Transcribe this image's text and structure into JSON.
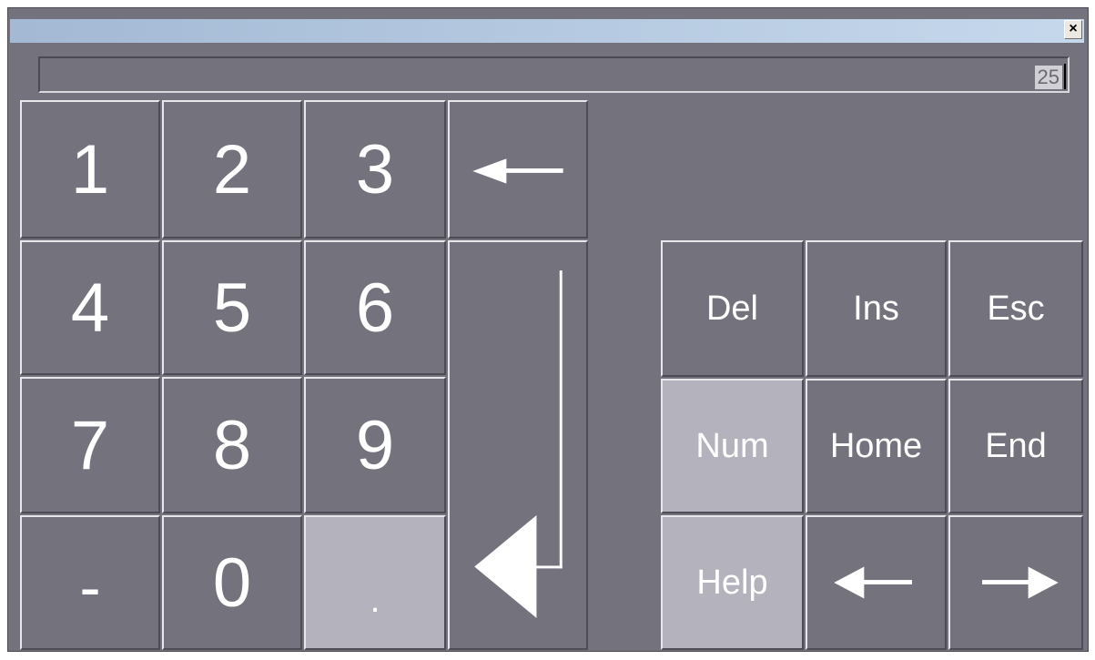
{
  "window": {
    "close_glyph": "×"
  },
  "input": {
    "value": "25"
  },
  "numpad": {
    "k1": "1",
    "k2": "2",
    "k3": "3",
    "k4": "4",
    "k5": "5",
    "k6": "6",
    "k7": "7",
    "k8": "8",
    "k9": "9",
    "minus": "-",
    "k0": "0",
    "dot": "."
  },
  "nav": {
    "del": "Del",
    "ins": "Ins",
    "esc": "Esc",
    "num": "Num",
    "home": "Home",
    "end": "End",
    "help": "Help"
  },
  "icons": {
    "backspace": "left-arrow-icon",
    "enter": "enter-arrow-icon",
    "cursor_left": "left-arrow-icon",
    "cursor_right": "right-arrow-icon"
  },
  "colors": {
    "panel": "#74737d",
    "key_active": "#b4b3bd",
    "title_bar_start": "#a3b9d4",
    "title_bar_end": "#c6d8ec"
  }
}
